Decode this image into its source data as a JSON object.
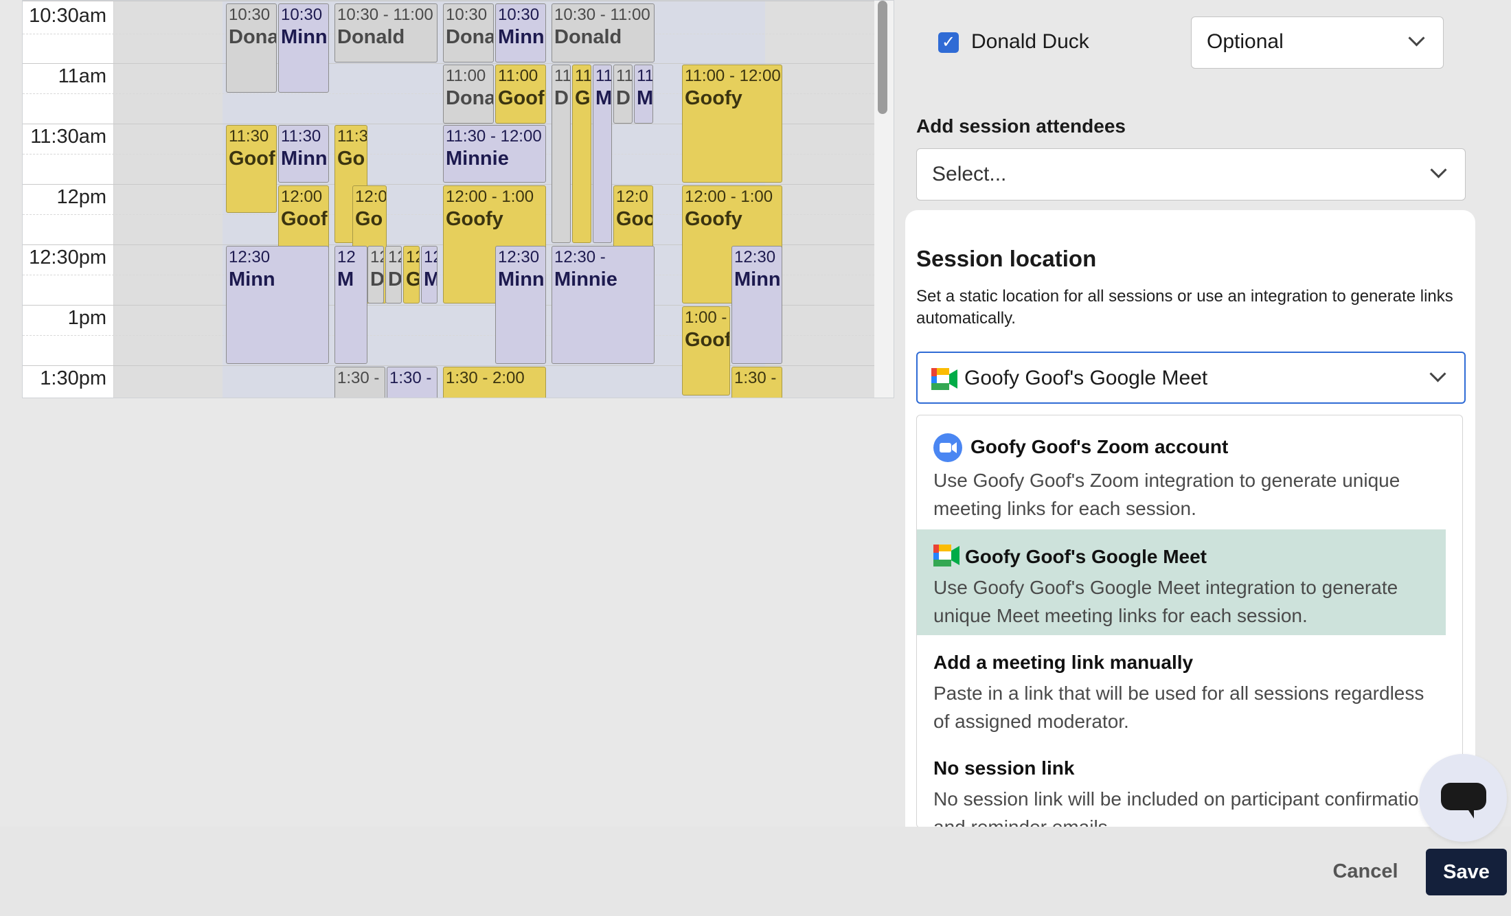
{
  "calendar": {
    "time_labels": [
      "10:30am",
      "11am",
      "11:30am",
      "12pm",
      "12:30pm",
      "1pm",
      "1:30pm"
    ],
    "events": [
      {
        "time": "10:30",
        "name": "Dona",
        "color": "gray"
      },
      {
        "time": "10:30",
        "name": "Minn",
        "color": "purple"
      },
      {
        "time": "10:30 - 11:00",
        "name": "Donald",
        "color": "gray"
      },
      {
        "time": "10:30",
        "name": "Dona",
        "color": "gray"
      },
      {
        "time": "10:30",
        "name": "Minn",
        "color": "purple"
      },
      {
        "time": "10:30 - 11:00",
        "name": "Donald",
        "color": "gray"
      },
      {
        "time": "11:00",
        "name": "Dona",
        "color": "gray"
      },
      {
        "time": "11:00",
        "name": "Goof",
        "color": "yellow"
      },
      {
        "time": "11",
        "name": "D",
        "color": "gray"
      },
      {
        "time": "11",
        "name": "G",
        "color": "yellow"
      },
      {
        "time": "11",
        "name": "M",
        "color": "purple"
      },
      {
        "time": "11",
        "name": "D",
        "color": "gray"
      },
      {
        "time": "11",
        "name": "M",
        "color": "purple"
      },
      {
        "time": "11:00 - 12:00",
        "name": "Goofy",
        "color": "yellow"
      },
      {
        "time": "11:30",
        "name": "Goof",
        "color": "yellow"
      },
      {
        "time": "11:30",
        "name": "Minn",
        "color": "purple"
      },
      {
        "time": "11:3",
        "name": "Go",
        "color": "yellow"
      },
      {
        "time": "11:30 - 12:00",
        "name": "Minnie",
        "color": "purple"
      },
      {
        "time": "12:00",
        "name": "Goof",
        "color": "yellow"
      },
      {
        "time": "12:0",
        "name": "Go",
        "color": "yellow"
      },
      {
        "time": "12:00 - 1:00",
        "name": "Goofy",
        "color": "yellow"
      },
      {
        "time": "12:0",
        "name": "Goo",
        "color": "yellow"
      },
      {
        "time": "12:00 - 1:00",
        "name": "Goofy",
        "color": "yellow"
      },
      {
        "time": "12:30",
        "name": "Minn",
        "color": "purple"
      },
      {
        "time": "12",
        "name": "M",
        "color": "purple"
      },
      {
        "time": "12",
        "name": "D",
        "color": "gray"
      },
      {
        "time": "12",
        "name": "D",
        "color": "gray"
      },
      {
        "time": "12",
        "name": "G",
        "color": "yellow"
      },
      {
        "time": "12",
        "name": "M",
        "color": "purple"
      },
      {
        "time": "12:30",
        "name": "Minn",
        "color": "purple"
      },
      {
        "time": "12:30 -",
        "name": "Minnie",
        "color": "purple"
      },
      {
        "time": "12:30",
        "name": "Minn",
        "color": "purple"
      },
      {
        "time": "1:00 -",
        "name": "Goof",
        "color": "yellow"
      },
      {
        "time": "1:30 -",
        "name": "",
        "color": "gray"
      },
      {
        "time": "1:30 -",
        "name": "",
        "color": "purple"
      },
      {
        "time": "1:30 - 2:00",
        "name": "",
        "color": "yellow"
      },
      {
        "time": "1:30 -",
        "name": "",
        "color": "yellow"
      }
    ]
  },
  "attendee": {
    "name": "Donald Duck",
    "checked": true,
    "role": "Optional"
  },
  "session_attendees": {
    "label": "Add session attendees",
    "placeholder": "Select..."
  },
  "session_location": {
    "title": "Session location",
    "description": "Set a static location for all sessions or use an integration to generate links automatically.",
    "selected": "Goofy Goof's Google Meet",
    "options": [
      {
        "title": "Goofy Goof's Zoom account",
        "description": "Use Goofy Goof's Zoom integration to generate unique meeting links for each session.",
        "icon": "zoom-icon"
      },
      {
        "title": "Goofy Goof's Google Meet",
        "description": "Use Goofy Goof's Google Meet integration to generate unique Meet meeting links for each session.",
        "icon": "google-meet-icon"
      },
      {
        "title": "Add a meeting link manually",
        "description": "Paste in a link that will be used for all sessions regardless of assigned moderator.",
        "icon": ""
      },
      {
        "title": "No session link",
        "description": "No session link will be included on participant confirmation and reminder emails.",
        "icon": ""
      }
    ]
  },
  "footer": {
    "cancel_label": "Cancel",
    "save_label": "Save"
  },
  "colors": {
    "selected_option_bg": "#cde2db",
    "save_button_bg": "#14203b",
    "checkbox_bg": "#2f6bd5",
    "event_yellow": "#e6cf5c",
    "event_purple": "#cfcde4",
    "event_gray": "#d4d4d4"
  }
}
